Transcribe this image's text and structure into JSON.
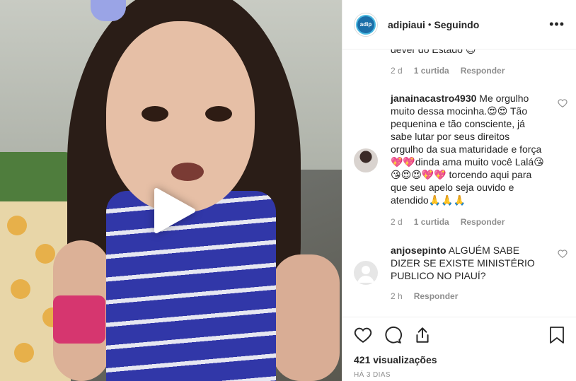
{
  "post": {
    "username": "adipiaui",
    "separator": "•",
    "follow_status": "Seguindo",
    "more_label": "•••",
    "logo_text": "adip"
  },
  "comments": {
    "partial_text": "dever do Estado 😉",
    "partial_meta": {
      "time": "2 d",
      "likes": "1 curtida",
      "reply": "Responder"
    },
    "items": [
      {
        "username": "janainacastro4930",
        "text": "Me orgulho muito dessa mocinha.😍😍 Tão pequenina e tão consciente, já sabe lutar por seus direitos orgulho da sua maturidade e força 💖💖dinda ama muito você Lalá😘😘😍😍💖💖 torcendo aqui para que seu apelo seja ouvido e atendido🙏🙏🙏",
        "time": "2 d",
        "likes": "1 curtida",
        "reply": "Responder"
      },
      {
        "username": "anjosepinto",
        "text": "ALGUÉM SABE DIZER SE EXISTE MINISTÉRIO PUBLICO NO PIAUÍ?",
        "time": "2 h",
        "reply": "Responder"
      }
    ]
  },
  "footer": {
    "views": "421 visualizações",
    "date": "HÁ 3 DIAS"
  },
  "icons": [
    "play-icon",
    "heart-icon",
    "comment-icon",
    "share-icon",
    "bookmark-icon"
  ],
  "colors": {
    "accent": "#262626",
    "muted": "#8e8e8e",
    "border": "#efefef"
  }
}
